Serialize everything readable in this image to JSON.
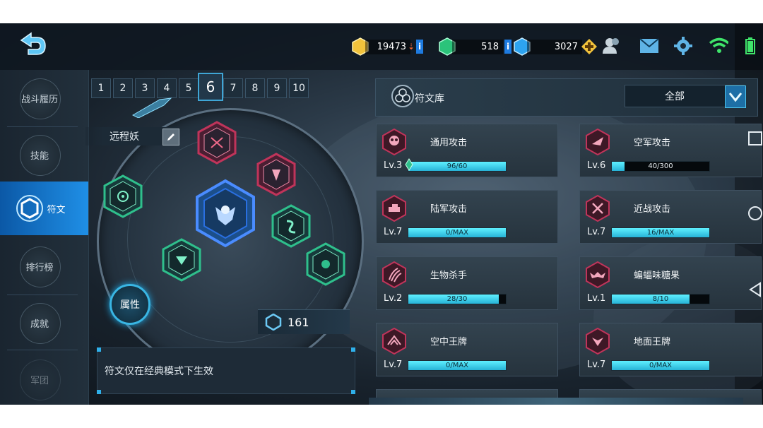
{
  "topbar": {
    "resources": [
      {
        "icon": "gold-coin-icon",
        "value": "19473"
      },
      {
        "icon": "green-gem-icon",
        "value": "518"
      },
      {
        "icon": "blue-crystal-icon",
        "value": "3027"
      }
    ],
    "plus_label": "i"
  },
  "nav": {
    "items": [
      {
        "label": "战斗履历"
      },
      {
        "label": "技能"
      },
      {
        "label": "符文"
      },
      {
        "label": "排行榜"
      },
      {
        "label": "成就"
      },
      {
        "label": "军团"
      }
    ],
    "active_index": 2
  },
  "pages": {
    "tabs": [
      "1",
      "2",
      "3",
      "4",
      "5",
      "6",
      "7",
      "8",
      "9",
      "10"
    ],
    "active": "6"
  },
  "loadout": {
    "preset_name": "远程妖",
    "attr_label": "属性",
    "points": "161",
    "note": "符文仅在经典模式下生效"
  },
  "library": {
    "title": "符文库",
    "filter": "全部",
    "cards": [
      {
        "name": "通用攻击",
        "level": "Lv.3",
        "progress": "96/60",
        "fill": 1.0,
        "color": "#c0345a"
      },
      {
        "name": "空军攻击",
        "level": "Lv.6",
        "progress": "40/300",
        "fill": 0.13,
        "color": "#c0345a"
      },
      {
        "name": "陆军攻击",
        "level": "Lv.7",
        "progress": "0/MAX",
        "fill": 1.0,
        "color": "#c0345a"
      },
      {
        "name": "近战攻击",
        "level": "Lv.7",
        "progress": "16/MAX",
        "fill": 1.0,
        "color": "#c0345a"
      },
      {
        "name": "生物杀手",
        "level": "Lv.2",
        "progress": "28/30",
        "fill": 0.93,
        "color": "#c0345a"
      },
      {
        "name": "蝙蝠味糖果",
        "level": "Lv.1",
        "progress": "8/10",
        "fill": 0.8,
        "color": "#c0345a"
      },
      {
        "name": "空中王牌",
        "level": "Lv.7",
        "progress": "0/MAX",
        "fill": 1.0,
        "color": "#c0345a"
      },
      {
        "name": "地面王牌",
        "level": "Lv.7",
        "progress": "0/MAX",
        "fill": 1.0,
        "color": "#c0345a"
      }
    ]
  },
  "colors": {
    "accent": "#2fb0ea",
    "rune_red": "#c0345a",
    "rune_green": "#2fbf8c",
    "rune_blue": "#2a6fe0"
  }
}
